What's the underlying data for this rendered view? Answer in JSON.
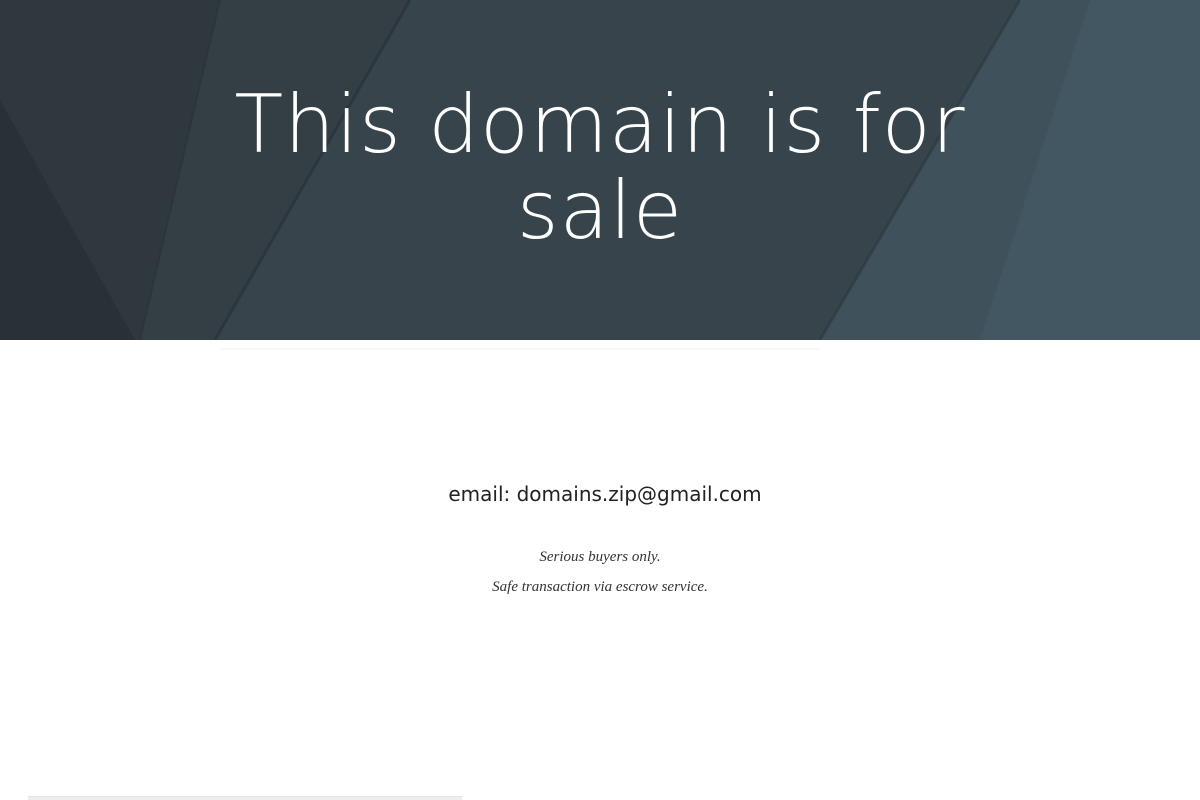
{
  "hero": {
    "title": "This domain is for sale",
    "background_color": "#3a464e"
  },
  "contact": {
    "email_line": "email: domains.zip@gmail.com"
  },
  "notes": {
    "line1": "Serious buyers only.",
    "line2": "Safe transaction via escrow service."
  },
  "colors": {
    "hero_dark": "#2d353b",
    "hero_mid": "#3a464e",
    "hero_light": "#445a65",
    "page_background": "#ffffff",
    "text_dark": "#222222"
  }
}
